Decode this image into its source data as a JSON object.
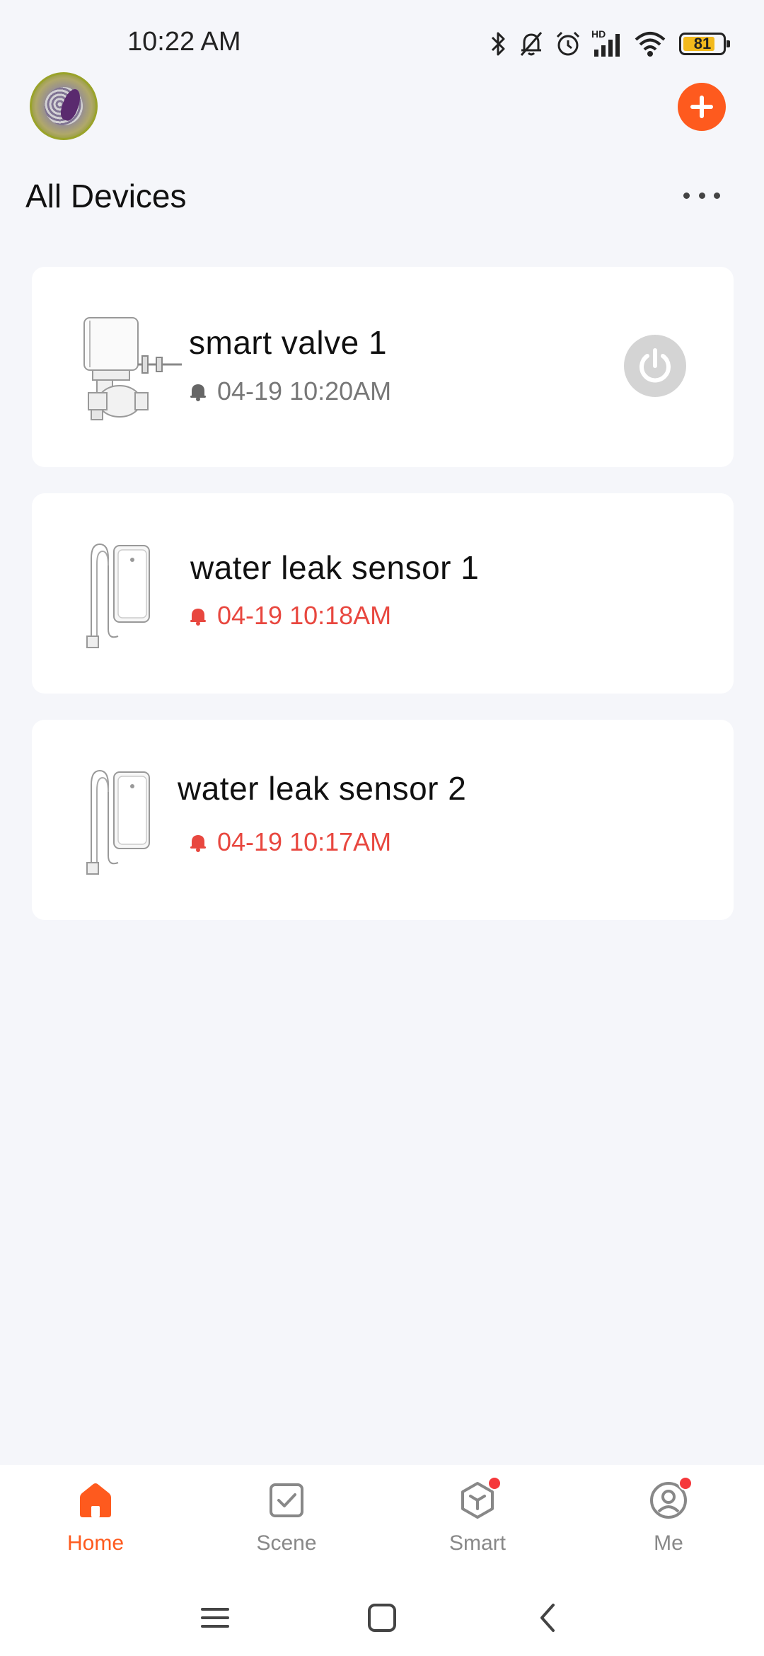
{
  "status_bar": {
    "time": "10:22 AM",
    "network_label": "HD",
    "battery_level": 81,
    "battery_text": "81",
    "icons": [
      "bluetooth-icon",
      "mute-bell-icon",
      "alarm-icon",
      "signal-icon",
      "wifi-icon",
      "battery-icon"
    ]
  },
  "header": {
    "title": "All Devices",
    "add_icon": "plus-icon",
    "more_icon": "ellipsis-icon"
  },
  "devices": [
    {
      "name": "smart valve 1",
      "time": "04-19 10:20AM",
      "alert": false,
      "image": "smart-valve",
      "has_power_button": true
    },
    {
      "name": "water leak sensor 1",
      "time": "04-19 10:18AM",
      "alert": true,
      "image": "water-leak-sensor"
    },
    {
      "name": "water leak sensor 2",
      "time": "04-19 10:17AM",
      "alert": true,
      "image": "water-leak-sensor"
    }
  ],
  "tabs": [
    {
      "label": "Home",
      "icon": "home-icon",
      "active": true,
      "badge": false
    },
    {
      "label": "Scene",
      "icon": "scene-check-icon",
      "active": false,
      "badge": false
    },
    {
      "label": "Smart",
      "icon": "smart-cube-icon",
      "active": false,
      "badge": true
    },
    {
      "label": "Me",
      "icon": "profile-icon",
      "active": false,
      "badge": true
    }
  ],
  "colors": {
    "accent": "#fe5a1e",
    "alert": "#e8473f",
    "badge": "#f5383b",
    "background": "#f5f6fa",
    "card": "#ffffff",
    "muted_text": "#777777"
  },
  "system_nav": [
    "menu-icon",
    "home-square-icon",
    "back-icon"
  ]
}
